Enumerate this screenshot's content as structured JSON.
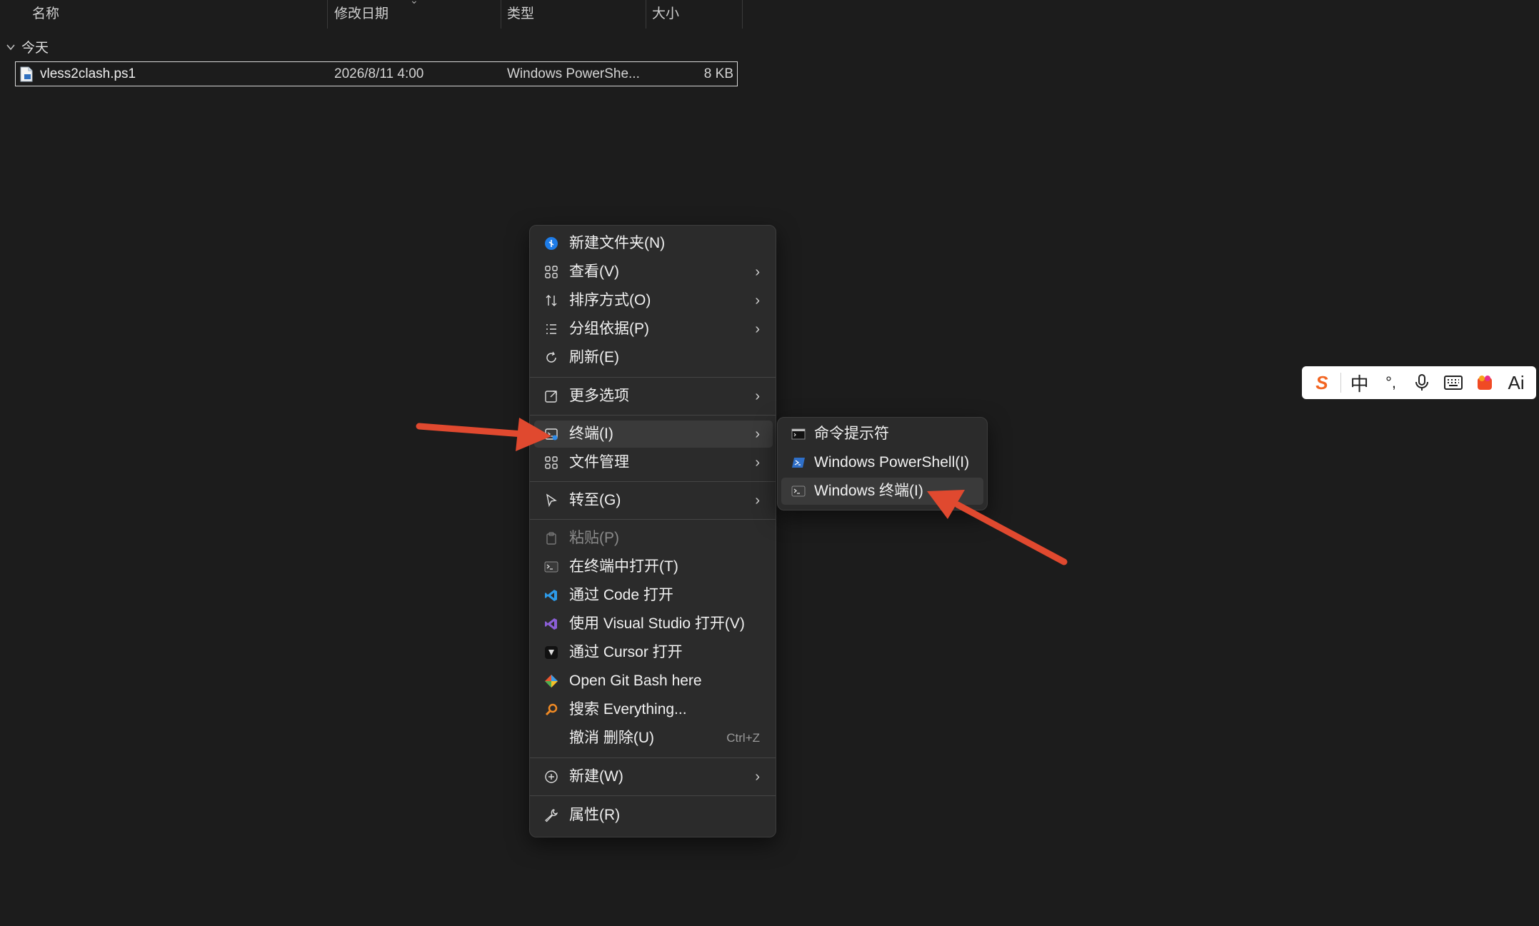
{
  "explorer": {
    "columns": [
      "名称",
      "修改日期",
      "类型",
      "大小"
    ],
    "group_label": "今天",
    "file": {
      "name": "vless2clash.ps1",
      "date": "2026/8/11 4:00",
      "type": "Windows PowerShe...",
      "size": "8 KB"
    }
  },
  "context_menu": {
    "items": [
      {
        "label": "新建文件夹(N)",
        "icon": "new-folder-icon"
      },
      {
        "label": "查看(V)",
        "icon": "view-grid-icon",
        "submenu": true
      },
      {
        "label": "排序方式(O)",
        "icon": "sort-icon",
        "submenu": true
      },
      {
        "label": "分组依据(P)",
        "icon": "group-by-icon",
        "submenu": true
      },
      {
        "label": "刷新(E)",
        "icon": "refresh-icon"
      },
      {
        "label": "更多选项",
        "icon": "more-options-icon",
        "submenu": true
      },
      {
        "label": "终端(I)",
        "icon": "terminal-icon",
        "submenu": true,
        "highlighted": true
      },
      {
        "label": "文件管理",
        "icon": "file-manage-icon",
        "submenu": true
      },
      {
        "label": "转至(G)",
        "icon": "goto-cursor-icon",
        "submenu": true
      },
      {
        "label": "粘贴(P)",
        "icon": "paste-icon",
        "disabled": true
      },
      {
        "label": "在终端中打开(T)",
        "icon": "terminal-icon"
      },
      {
        "label": "通过 Code 打开",
        "icon": "vscode-icon"
      },
      {
        "label": "使用 Visual Studio 打开(V)",
        "icon": "visual-studio-icon"
      },
      {
        "label": "通过 Cursor 打开",
        "icon": "cursor-app-icon"
      },
      {
        "label": "Open Git Bash here",
        "icon": "git-icon"
      },
      {
        "label": "搜索 Everything...",
        "icon": "everything-search-icon"
      },
      {
        "label": "撤消 删除(U)",
        "shortcut": "Ctrl+Z"
      },
      {
        "label": "新建(W)",
        "icon": "new-plus-icon",
        "submenu": true
      },
      {
        "label": "属性(R)",
        "icon": "wrench-icon"
      }
    ]
  },
  "terminal_submenu": {
    "items": [
      {
        "label": "命令提示符",
        "icon": "cmd-icon"
      },
      {
        "label": "Windows PowerShell(I)",
        "icon": "powershell-icon"
      },
      {
        "label": "Windows 终端(I)",
        "icon": "windows-terminal-icon",
        "highlighted": true
      }
    ]
  },
  "ime_toolbar": {
    "items": [
      "S",
      "中",
      "°,",
      "mic",
      "keyboard",
      "skin",
      "Ai"
    ]
  },
  "colors": {
    "background": "#1c1c1c",
    "menu": "#2b2b2b",
    "highlight": "#3a3a3a",
    "annotation_arrow": "#e0492f",
    "ime_brand": "#f26522"
  }
}
